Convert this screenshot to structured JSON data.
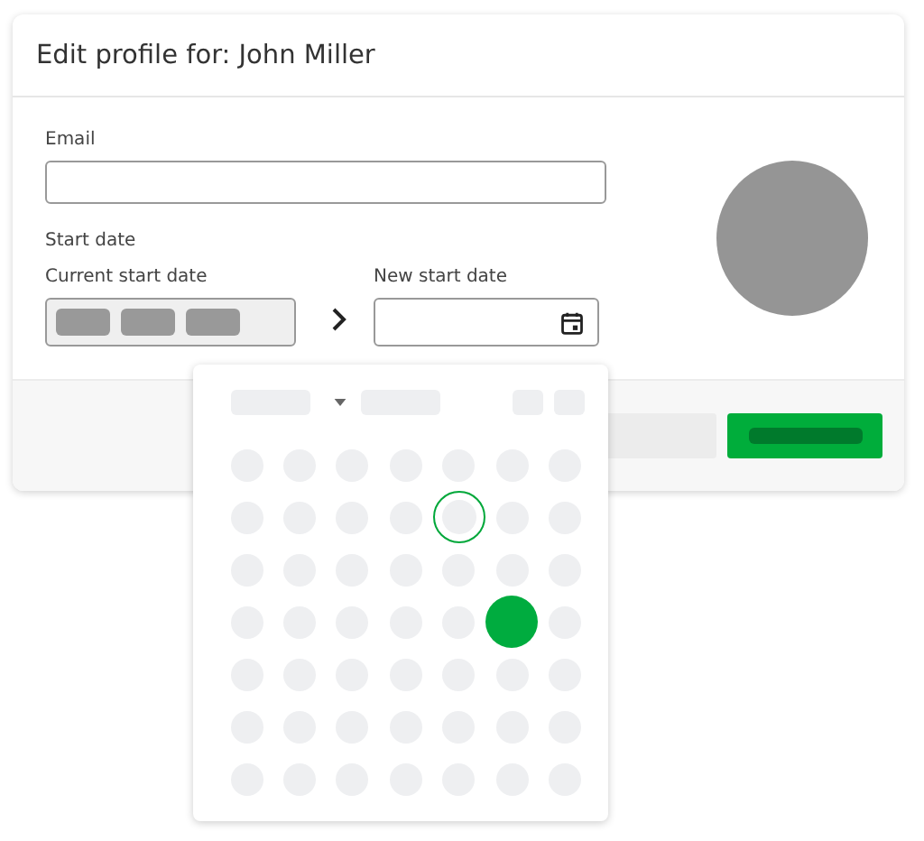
{
  "dialog": {
    "title": "Edit profile for: John Miller"
  },
  "form": {
    "email_label": "Email",
    "start_date_label": "Start date",
    "current_start_date_label": "Current start date",
    "new_start_date_label": "New start date"
  },
  "calendar": {
    "weeks": [
      {
        "days": [
          {
            "selected": false,
            "today": false
          },
          {
            "selected": false,
            "today": false
          },
          {
            "selected": false,
            "today": false
          },
          {
            "selected": false,
            "today": false
          },
          {
            "selected": false,
            "today": false
          },
          {
            "selected": false,
            "today": false
          },
          {
            "selected": false,
            "today": false
          }
        ]
      },
      {
        "days": [
          {
            "selected": false,
            "today": false
          },
          {
            "selected": false,
            "today": false
          },
          {
            "selected": false,
            "today": false
          },
          {
            "selected": false,
            "today": false
          },
          {
            "selected": false,
            "today": true
          },
          {
            "selected": false,
            "today": false
          },
          {
            "selected": false,
            "today": false
          }
        ]
      },
      {
        "days": [
          {
            "selected": false,
            "today": false
          },
          {
            "selected": false,
            "today": false
          },
          {
            "selected": false,
            "today": false
          },
          {
            "selected": false,
            "today": false
          },
          {
            "selected": false,
            "today": false
          },
          {
            "selected": false,
            "today": false
          },
          {
            "selected": false,
            "today": false
          }
        ]
      },
      {
        "days": [
          {
            "selected": false,
            "today": false
          },
          {
            "selected": false,
            "today": false
          },
          {
            "selected": false,
            "today": false
          },
          {
            "selected": false,
            "today": false
          },
          {
            "selected": false,
            "today": false
          },
          {
            "selected": true,
            "today": false
          },
          {
            "selected": false,
            "today": false
          }
        ]
      },
      {
        "days": [
          {
            "selected": false,
            "today": false
          },
          {
            "selected": false,
            "today": false
          },
          {
            "selected": false,
            "today": false
          },
          {
            "selected": false,
            "today": false
          },
          {
            "selected": false,
            "today": false
          },
          {
            "selected": false,
            "today": false
          },
          {
            "selected": false,
            "today": false
          }
        ]
      },
      {
        "days": [
          {
            "selected": false,
            "today": false
          },
          {
            "selected": false,
            "today": false
          },
          {
            "selected": false,
            "today": false
          },
          {
            "selected": false,
            "today": false
          },
          {
            "selected": false,
            "today": false
          },
          {
            "selected": false,
            "today": false
          },
          {
            "selected": false,
            "today": false
          }
        ]
      },
      {
        "days": [
          {
            "selected": false,
            "today": false
          },
          {
            "selected": false,
            "today": false
          },
          {
            "selected": false,
            "today": false
          },
          {
            "selected": false,
            "today": false
          },
          {
            "selected": false,
            "today": false
          },
          {
            "selected": false,
            "today": false
          },
          {
            "selected": false,
            "today": false
          }
        ]
      }
    ]
  }
}
